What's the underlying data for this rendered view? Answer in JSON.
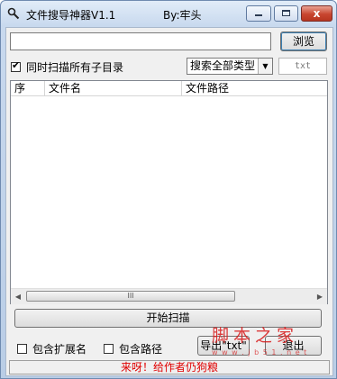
{
  "window": {
    "title": "文件搜导神器V1.1",
    "author": "By:牢头",
    "controls": {
      "minimize_icon": "minimize-icon",
      "maximize_icon": "maximize-icon",
      "close_glyph": "x"
    }
  },
  "search": {
    "path_value": "",
    "path_placeholder": "",
    "browse_label": "浏览"
  },
  "options": {
    "scan_subdirs_label": "同时扫描所有子目录",
    "scan_subdirs_checked": true,
    "type_select_value": "搜索全部类型",
    "ext_value": "txt"
  },
  "results": {
    "columns": [
      "序",
      "文件名",
      "文件路径"
    ],
    "rows": [],
    "scroll_grip": "III"
  },
  "actions": {
    "start_label": "开始扫描",
    "export_label": "导出\"txt\"",
    "exit_label": "退出"
  },
  "bottom_options": {
    "include_ext_label": "包含扩展名",
    "include_ext_checked": false,
    "include_path_label": "包含路径",
    "include_path_checked": false
  },
  "status": {
    "text": "来呀！给作者仍狗粮"
  },
  "watermark": {
    "main": "脚本之家",
    "sub": "w w w . j b 5 1 . n e t"
  },
  "colors": {
    "status_text": "#e00000",
    "close_button": "#c8462f",
    "window_frame": "#b9cde6"
  }
}
